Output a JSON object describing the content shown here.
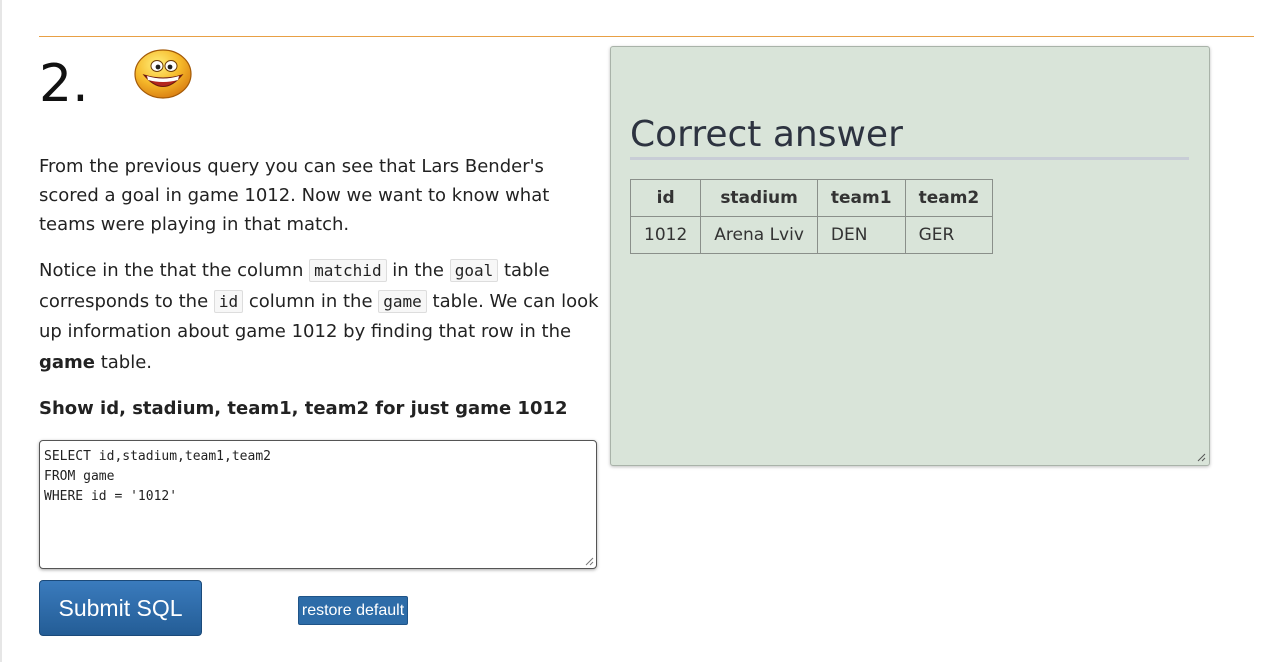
{
  "question": {
    "number": "2.",
    "paragraph1": "From the previous query you can see that Lars Bender's scored a goal in game 1012. Now we want to know what teams were playing in that match.",
    "paragraph2": {
      "t1": "Notice in the that the column ",
      "c1": "matchid",
      "t2": " in the ",
      "c2": "goal",
      "t3": " table corresponds to the ",
      "c3": "id",
      "t4": " column in the ",
      "c4": "game",
      "t5": " table. We can look up information about game 1012 by finding that row in the ",
      "b1": "game",
      "t6": " table."
    },
    "instruction": "Show id, stadium, team1, team2 for just game 1012"
  },
  "editor": {
    "sql": "SELECT id,stadium,team1,team2\nFROM game\nWHERE id = '1012'"
  },
  "buttons": {
    "submit": "Submit SQL",
    "restore": "restore default"
  },
  "answer": {
    "title": "Correct answer",
    "columns": [
      "id",
      "stadium",
      "team1",
      "team2"
    ],
    "rows": [
      [
        "1012",
        "Arena Lviv",
        "DEN",
        "GER"
      ]
    ]
  },
  "colors": {
    "rule": "#e8a045",
    "panel_bg": "#d9e4d9",
    "button_blue": "#2d6ca8"
  },
  "icons": {
    "smiley": "grinning-face-icon"
  }
}
